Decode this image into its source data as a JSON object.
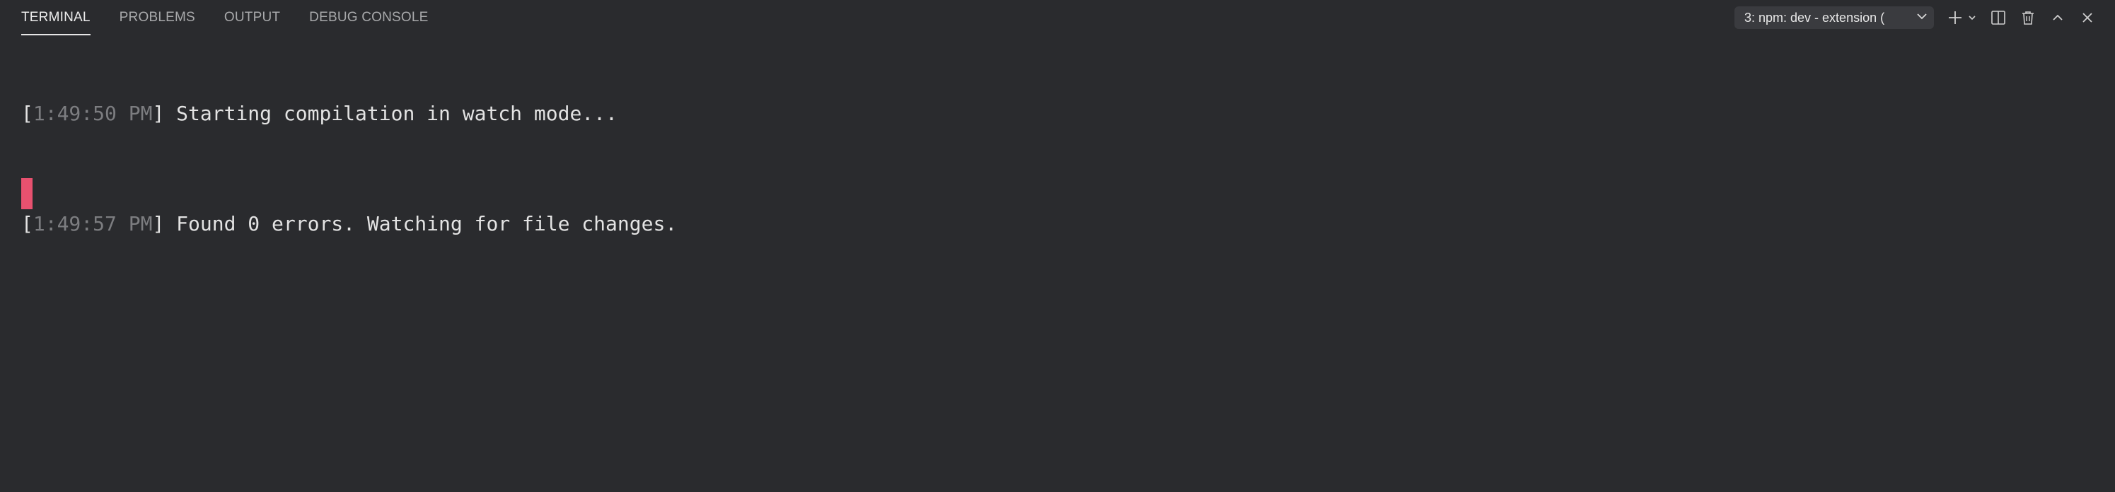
{
  "tabs": [
    {
      "label": "TERMINAL",
      "active": true
    },
    {
      "label": "PROBLEMS",
      "active": false
    },
    {
      "label": "OUTPUT",
      "active": false
    },
    {
      "label": "DEBUG CONSOLE",
      "active": false
    }
  ],
  "terminal_select": {
    "value": "3: npm: dev - extension ("
  },
  "actions": {
    "new_terminal_icon": "plus-icon",
    "launch_profile_icon": "chevron-down-icon",
    "split_icon": "split-terminal-icon",
    "kill_icon": "trash-icon",
    "maximize_icon": "chevron-up-icon",
    "close_icon": "close-icon"
  },
  "terminal": {
    "lines": [
      {
        "open": "[",
        "timestamp": "1:49:50 PM",
        "close": "]",
        "message": " Starting compilation in watch mode..."
      },
      {
        "open": "[",
        "timestamp": "1:49:57 PM",
        "close": "]",
        "message": " Found 0 errors. Watching for file changes."
      }
    ]
  },
  "colors": {
    "background": "#2a2b2e",
    "cursor": "#e8516f",
    "timestamp": "#7c7d80",
    "text": "#e3e3e3"
  }
}
